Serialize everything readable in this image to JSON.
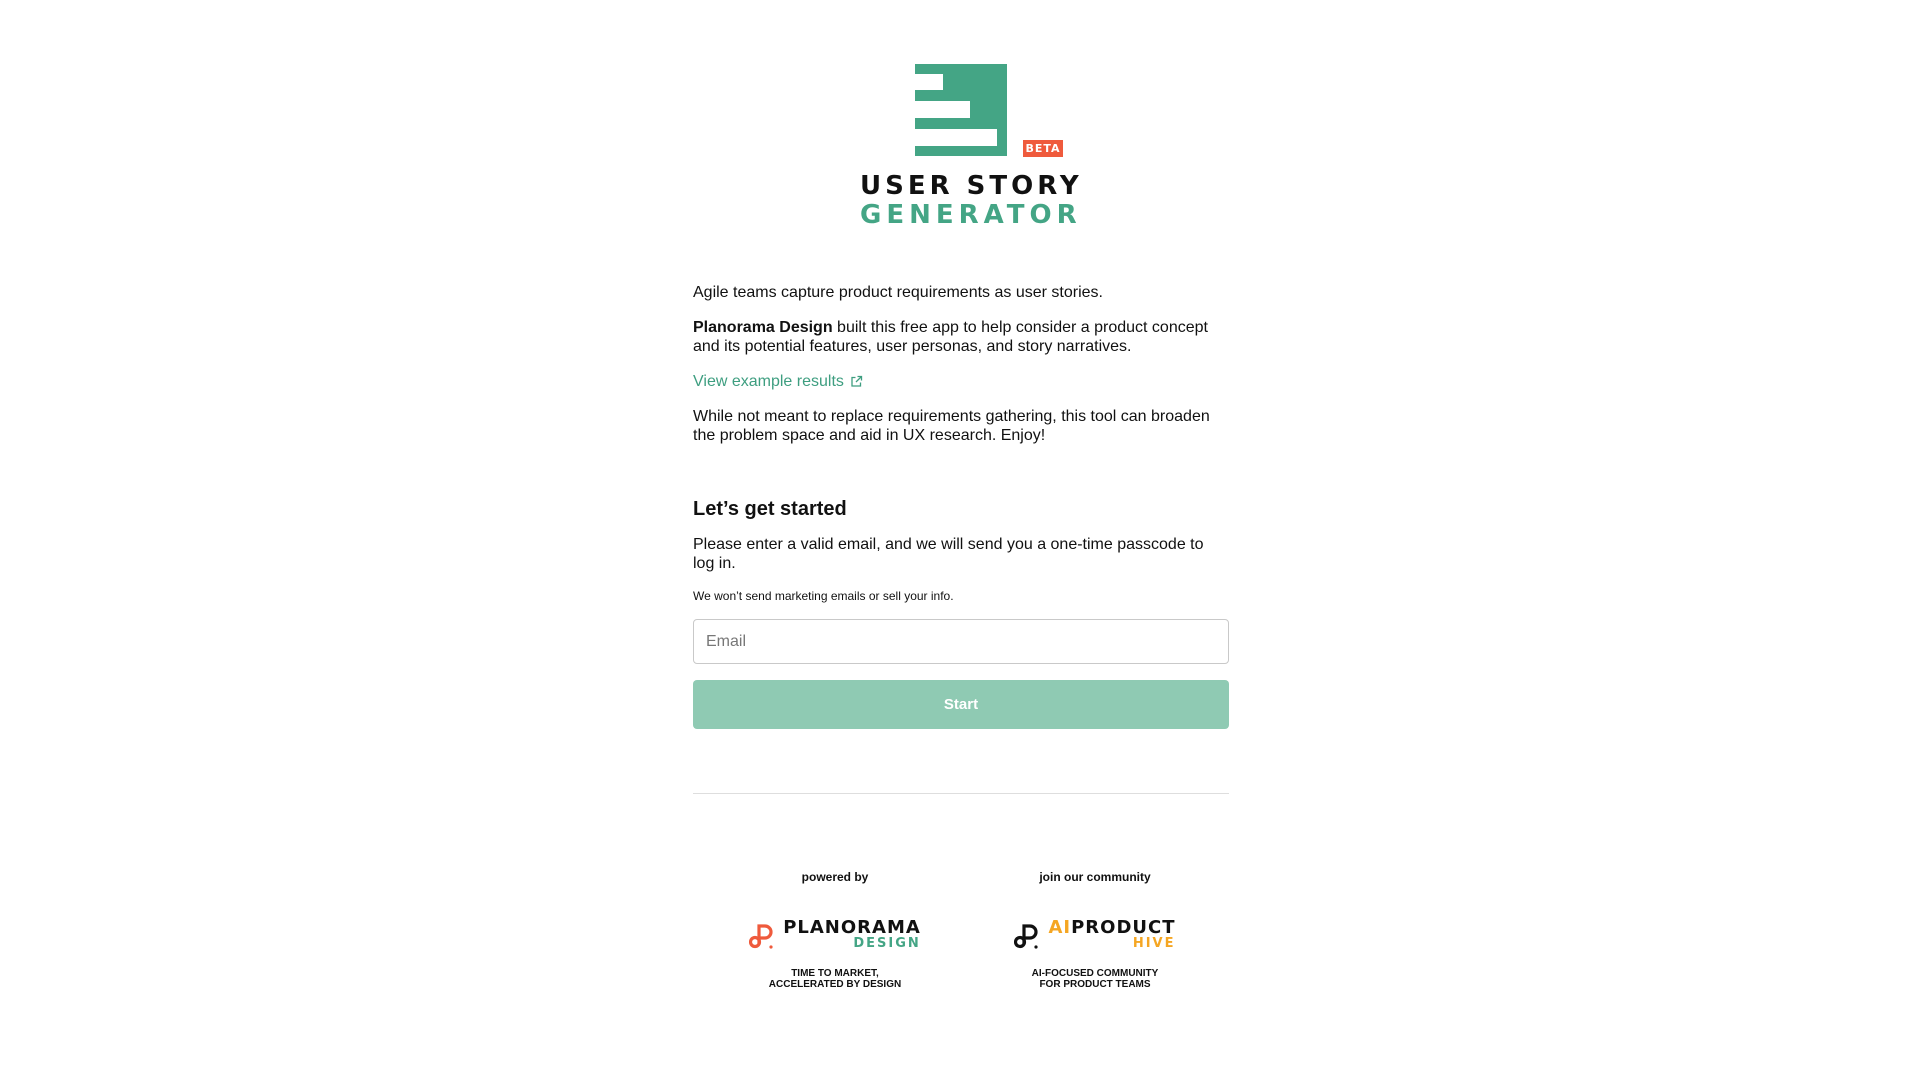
{
  "logo": {
    "line1": "USER STORY",
    "line2": "GENERATOR",
    "badge": "BETA",
    "colors": {
      "green": "#44a585",
      "badge": "#ef5a3c"
    }
  },
  "intro": {
    "paragraph1": "Agile teams capture product requirements as user stories.",
    "paragraph2_strong": "Planorama Design",
    "paragraph2_rest": " built this free app to help consider a product concept and its potential features, user personas, and story narratives.",
    "example_link": "View example results",
    "paragraph3": "While not meant to replace requirements gathering, this tool can broaden the problem space and aid in UX research. Enjoy!"
  },
  "signup": {
    "title": "Let’s get started",
    "instructions": "Please enter a valid email, and we will send you a one-time passcode to log in.",
    "privacy_note": "We won’t send marketing emails or sell your info.",
    "email_value": "",
    "email_placeholder": "Email",
    "start_label": "Start",
    "button_color": "#8fcab3"
  },
  "footer": {
    "powered": {
      "caption": "powered by",
      "brand_name": "PLANORAMA",
      "brand_sub": "DESIGN",
      "tagline_line1": "TIME TO MARKET,",
      "tagline_line2": "ACCELERATED BY DESIGN",
      "accent": "#ef5a3c",
      "sub_color": "#44a585"
    },
    "community": {
      "caption": "join our community",
      "brand_prefix": "AI",
      "brand_name": "PRODUCT",
      "brand_sub": "HIVE",
      "tagline_line1": "AI-FOCUSED COMMUNITY",
      "tagline_line2": "FOR PRODUCT TEAMS",
      "accent": "#f5a623"
    }
  }
}
